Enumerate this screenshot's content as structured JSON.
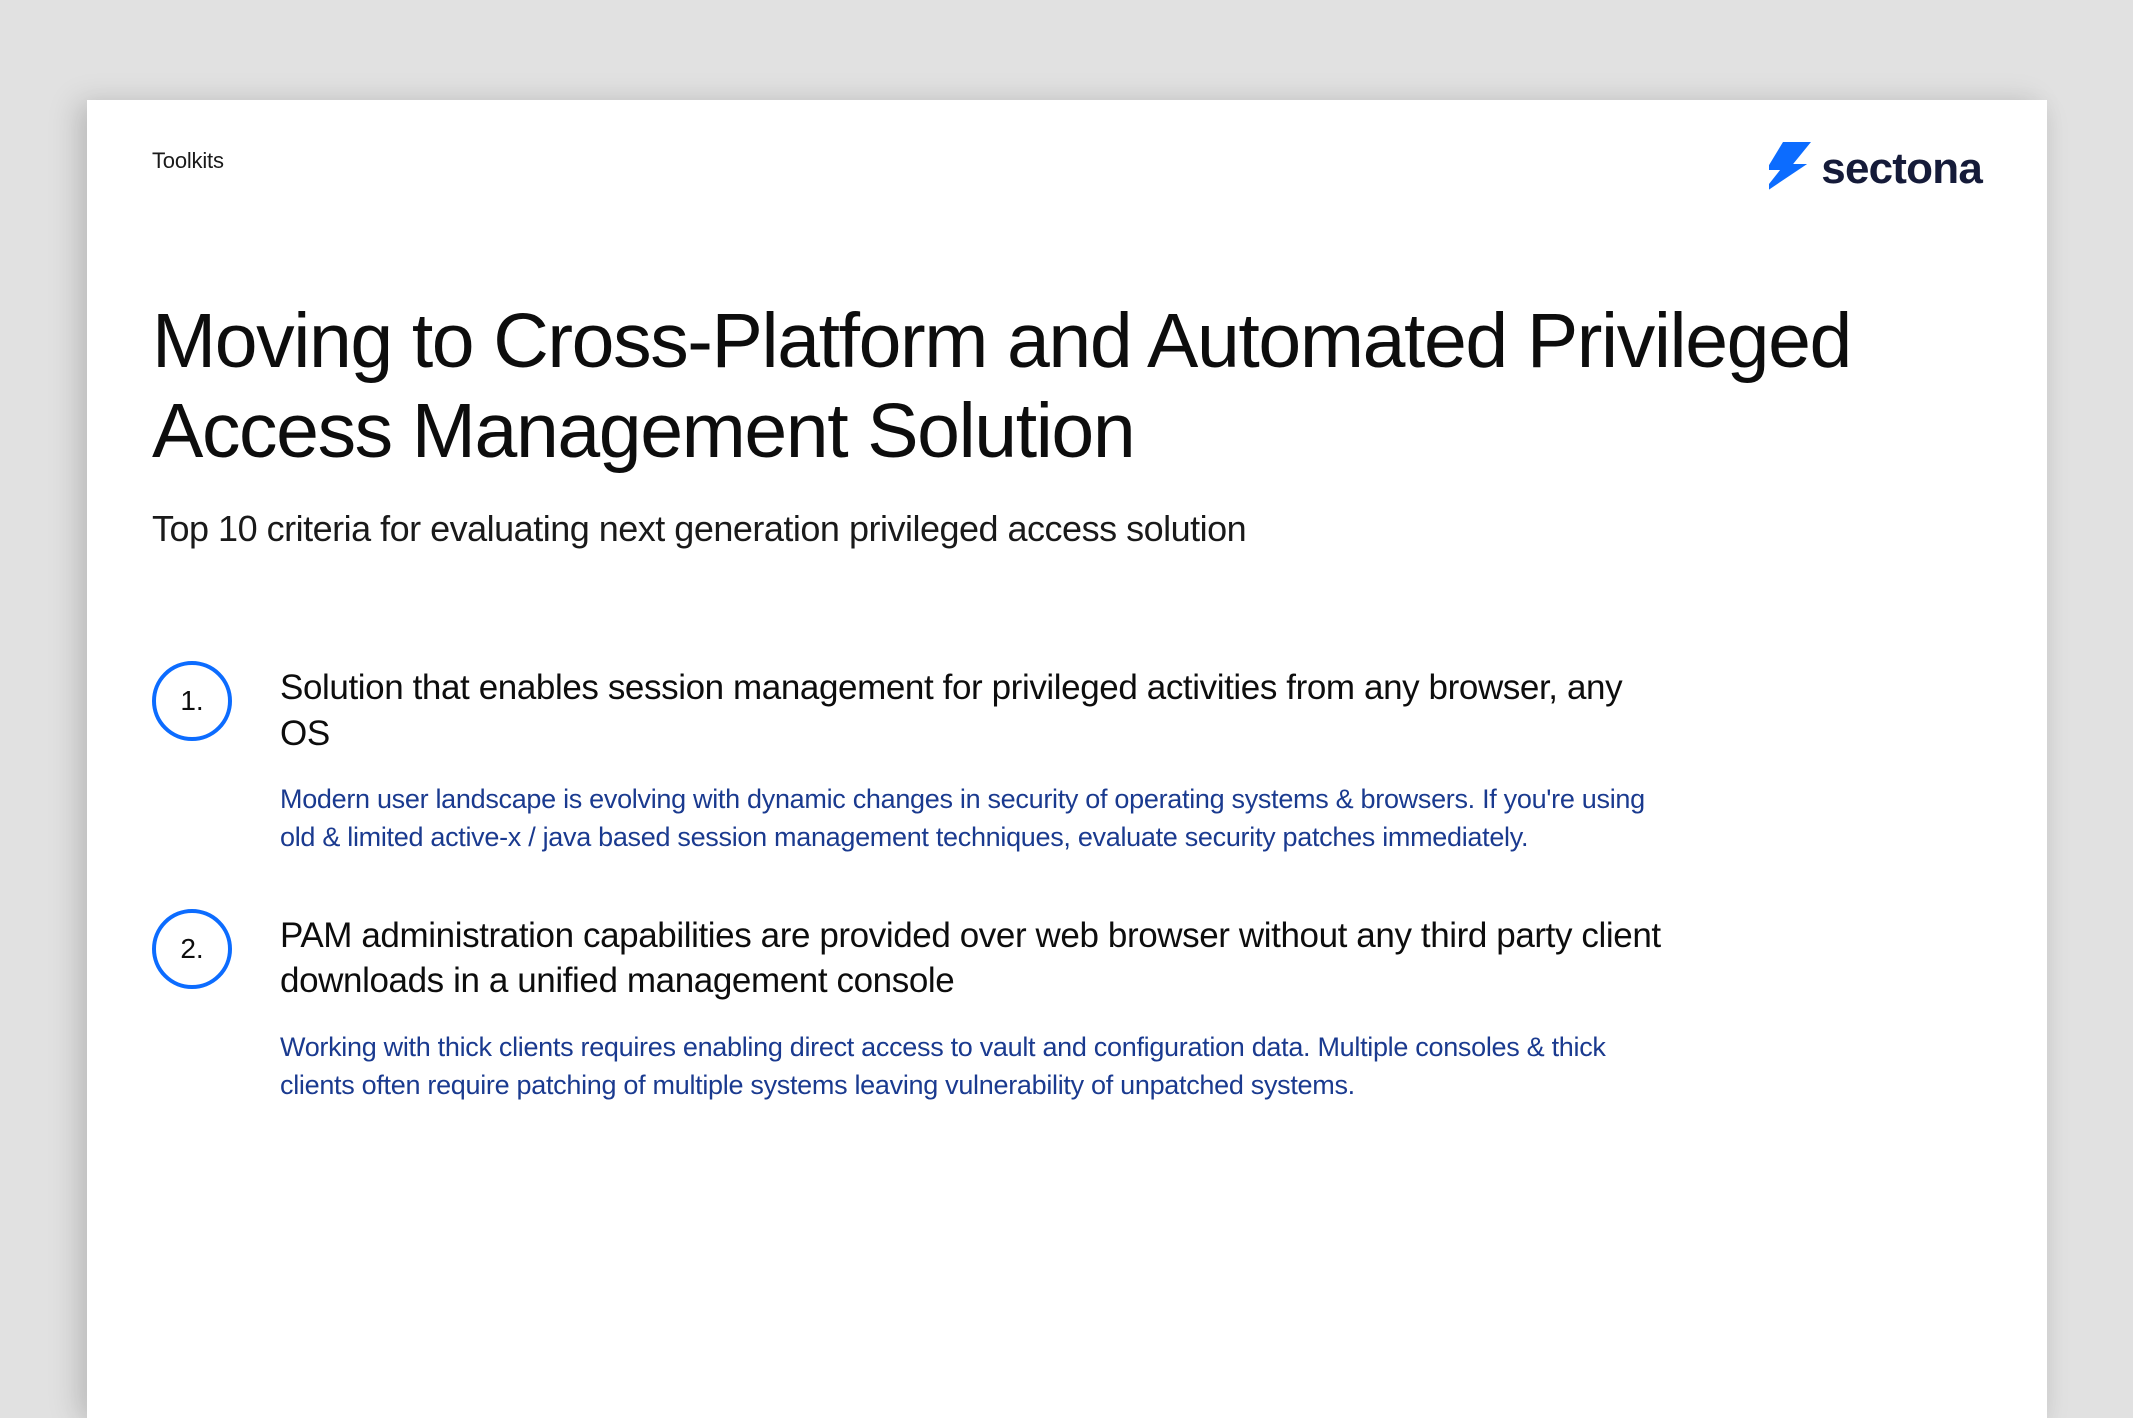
{
  "header": {
    "category": "Toolkits",
    "logo_text": "sectona"
  },
  "main": {
    "title": "Moving to Cross-Platform and Automated Privileged Access Management Solution",
    "subtitle": "Top 10 criteria for evaluating next generation privileged access solution"
  },
  "criteria": [
    {
      "number": "1.",
      "heading": "Solution that enables session management for privileged activities from any browser, any OS",
      "description": "Modern user landscape is evolving with dynamic changes in security of operating systems & browsers. If you're using old & limited active-x / java based session management techniques, evaluate security patches immediately."
    },
    {
      "number": "2.",
      "heading": "PAM administration capabilities are provided over web browser without any third party client downloads in a unified management console",
      "description": "Working with thick clients requires enabling direct access to vault and configuration data. Multiple consoles & thick clients often require patching of multiple systems leaving vulnerability of unpatched systems."
    }
  ]
}
